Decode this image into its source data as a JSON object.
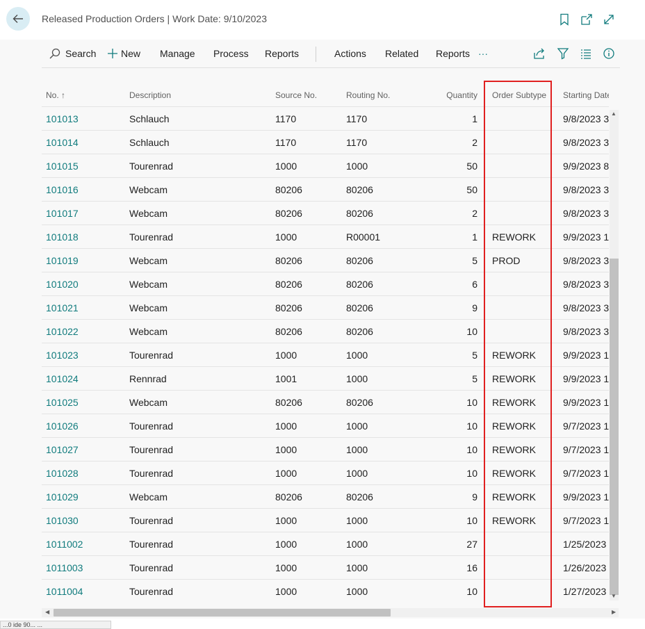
{
  "header": {
    "title": "Released Production Orders | Work Date: 9/10/2023"
  },
  "actions": {
    "search": "Search",
    "new": "New",
    "manage": "Manage",
    "process": "Process",
    "reports1": "Reports",
    "actions": "Actions",
    "related": "Related",
    "reports2": "Reports",
    "more": "···"
  },
  "columns": {
    "no": "No. ↑",
    "description": "Description",
    "source_no": "Source No.",
    "routing_no": "Routing No.",
    "quantity": "Quantity",
    "order_subtype": "Order Subtype",
    "starting_date": "Starting Date-Ti"
  },
  "rows": [
    {
      "no": "101013",
      "description": "Schlauch",
      "source_no": "1170",
      "routing_no": "1170",
      "quantity": "1",
      "order_subtype": "",
      "starting": "9/8/2023 3"
    },
    {
      "no": "101014",
      "description": "Schlauch",
      "source_no": "1170",
      "routing_no": "1170",
      "quantity": "2",
      "order_subtype": "",
      "starting": "9/8/2023 3"
    },
    {
      "no": "101015",
      "description": "Tourenrad",
      "source_no": "1000",
      "routing_no": "1000",
      "quantity": "50",
      "order_subtype": "",
      "starting": "9/9/2023 8"
    },
    {
      "no": "101016",
      "description": "Webcam",
      "source_no": "80206",
      "routing_no": "80206",
      "quantity": "50",
      "order_subtype": "",
      "starting": "9/8/2023 3"
    },
    {
      "no": "101017",
      "description": "Webcam",
      "source_no": "80206",
      "routing_no": "80206",
      "quantity": "2",
      "order_subtype": "",
      "starting": "9/8/2023 3"
    },
    {
      "no": "101018",
      "description": "Tourenrad",
      "source_no": "1000",
      "routing_no": "R00001",
      "quantity": "1",
      "order_subtype": "REWORK",
      "starting": "9/9/2023 1"
    },
    {
      "no": "101019",
      "description": "Webcam",
      "source_no": "80206",
      "routing_no": "80206",
      "quantity": "5",
      "order_subtype": "PROD",
      "starting": "9/8/2023 3"
    },
    {
      "no": "101020",
      "description": "Webcam",
      "source_no": "80206",
      "routing_no": "80206",
      "quantity": "6",
      "order_subtype": "",
      "starting": "9/8/2023 3"
    },
    {
      "no": "101021",
      "description": "Webcam",
      "source_no": "80206",
      "routing_no": "80206",
      "quantity": "9",
      "order_subtype": "",
      "starting": "9/8/2023 3"
    },
    {
      "no": "101022",
      "description": "Webcam",
      "source_no": "80206",
      "routing_no": "80206",
      "quantity": "10",
      "order_subtype": "",
      "starting": "9/8/2023 3"
    },
    {
      "no": "101023",
      "description": "Tourenrad",
      "source_no": "1000",
      "routing_no": "1000",
      "quantity": "5",
      "order_subtype": "REWORK",
      "starting": "9/9/2023 1"
    },
    {
      "no": "101024",
      "description": "Rennrad",
      "source_no": "1001",
      "routing_no": "1000",
      "quantity": "5",
      "order_subtype": "REWORK",
      "starting": "9/9/2023 1"
    },
    {
      "no": "101025",
      "description": "Webcam",
      "source_no": "80206",
      "routing_no": "80206",
      "quantity": "10",
      "order_subtype": "REWORK",
      "starting": "9/9/2023 1"
    },
    {
      "no": "101026",
      "description": "Tourenrad",
      "source_no": "1000",
      "routing_no": "1000",
      "quantity": "10",
      "order_subtype": "REWORK",
      "starting": "9/7/2023 1"
    },
    {
      "no": "101027",
      "description": "Tourenrad",
      "source_no": "1000",
      "routing_no": "1000",
      "quantity": "10",
      "order_subtype": "REWORK",
      "starting": "9/7/2023 1"
    },
    {
      "no": "101028",
      "description": "Tourenrad",
      "source_no": "1000",
      "routing_no": "1000",
      "quantity": "10",
      "order_subtype": "REWORK",
      "starting": "9/7/2023 1"
    },
    {
      "no": "101029",
      "description": "Webcam",
      "source_no": "80206",
      "routing_no": "80206",
      "quantity": "9",
      "order_subtype": "REWORK",
      "starting": "9/9/2023 1"
    },
    {
      "no": "101030",
      "description": "Tourenrad",
      "source_no": "1000",
      "routing_no": "1000",
      "quantity": "10",
      "order_subtype": "REWORK",
      "starting": "9/7/2023 1"
    },
    {
      "no": "1011002",
      "description": "Tourenrad",
      "source_no": "1000",
      "routing_no": "1000",
      "quantity": "27",
      "order_subtype": "",
      "starting": "1/25/2023"
    },
    {
      "no": "1011003",
      "description": "Tourenrad",
      "source_no": "1000",
      "routing_no": "1000",
      "quantity": "16",
      "order_subtype": "",
      "starting": "1/26/2023"
    },
    {
      "no": "1011004",
      "description": "Tourenrad",
      "source_no": "1000",
      "routing_no": "1000",
      "quantity": "10",
      "order_subtype": "",
      "starting": "1/27/2023"
    }
  ],
  "status_tip": "...0 ide 90... ..."
}
